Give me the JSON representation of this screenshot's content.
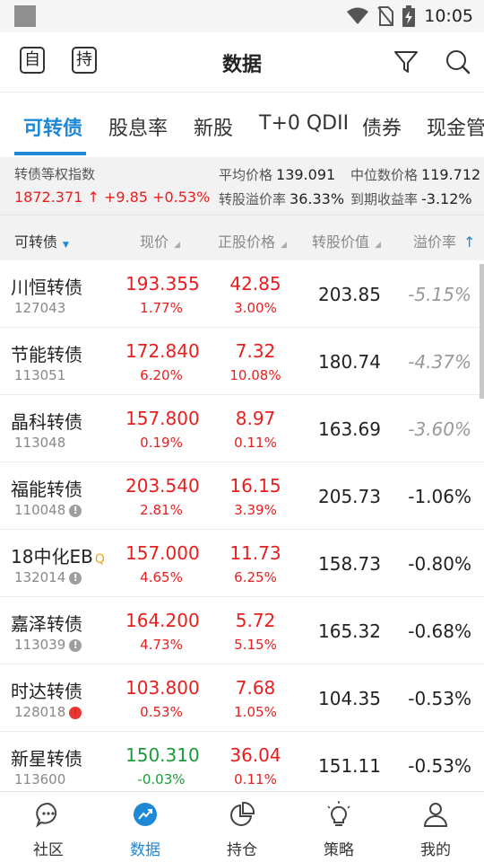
{
  "status": {
    "time": "10:05"
  },
  "header": {
    "title": "数据",
    "left_buttons": [
      "自",
      "持"
    ],
    "icons": [
      "filter-icon",
      "search-icon"
    ]
  },
  "tabs": [
    "可转债",
    "股息率",
    "新股",
    "T+0 QDII",
    "债券",
    "现金管"
  ],
  "index": {
    "name": "转债等权指数",
    "value": "1872.371",
    "arrow": "↑",
    "change": "+9.85",
    "change_pct": "+0.53%",
    "avg_price_label": "平均价格",
    "avg_price": "139.091",
    "median_label": "中位数价格",
    "median": "119.712",
    "premium_label": "转股溢价率",
    "premium": "36.33%",
    "ytm_label": "到期收益率",
    "ytm": "-3.12%"
  },
  "columns": {
    "name": "可转债",
    "price": "现价",
    "stock_price": "正股价格",
    "conv_value": "转股价值",
    "premium": "溢价率"
  },
  "rows": [
    {
      "name": "川恒转债",
      "code": "127043",
      "price": "193.355",
      "price_chg": "1.77%",
      "stock_price": "42.85",
      "stock_chg": "3.00%",
      "conv_value": "203.85",
      "premium": "-5.15%"
    },
    {
      "name": "节能转债",
      "code": "113051",
      "price": "172.840",
      "price_chg": "6.20%",
      "stock_price": "7.32",
      "stock_chg": "10.08%",
      "conv_value": "180.74",
      "premium": "-4.37%"
    },
    {
      "name": "晶科转债",
      "code": "113048",
      "price": "157.800",
      "price_chg": "0.19%",
      "stock_price": "8.97",
      "stock_chg": "0.11%",
      "conv_value": "163.69",
      "premium": "-3.60%"
    },
    {
      "name": "福能转债",
      "code": "110048",
      "price": "203.540",
      "price_chg": "2.81%",
      "stock_price": "16.15",
      "stock_chg": "3.39%",
      "conv_value": "205.73",
      "premium": "-1.06%"
    },
    {
      "name": "18中化EB",
      "code": "132014",
      "price": "157.000",
      "price_chg": "4.65%",
      "stock_price": "11.73",
      "stock_chg": "6.25%",
      "conv_value": "158.73",
      "premium": "-0.80%",
      "badge": "Q"
    },
    {
      "name": "嘉泽转债",
      "code": "113039",
      "price": "164.200",
      "price_chg": "4.73%",
      "stock_price": "5.72",
      "stock_chg": "5.15%",
      "conv_value": "165.32",
      "premium": "-0.68%"
    },
    {
      "name": "时达转债",
      "code": "128018",
      "price": "103.800",
      "price_chg": "0.53%",
      "stock_price": "7.68",
      "stock_chg": "1.05%",
      "conv_value": "104.35",
      "premium": "-0.53%"
    },
    {
      "name": "新星转债",
      "code": "113600",
      "price": "150.310",
      "price_chg": "-0.03%",
      "stock_price": "36.04",
      "stock_chg": "0.11%",
      "conv_value": "151.11",
      "premium": "-0.53%"
    }
  ],
  "colors": {
    "accent": "#1e88d6",
    "up": "#e81e1e",
    "down": "#1a9b3a",
    "muted": "#999999"
  },
  "nav": [
    "社区",
    "数据",
    "持仓",
    "策略",
    "我的"
  ]
}
